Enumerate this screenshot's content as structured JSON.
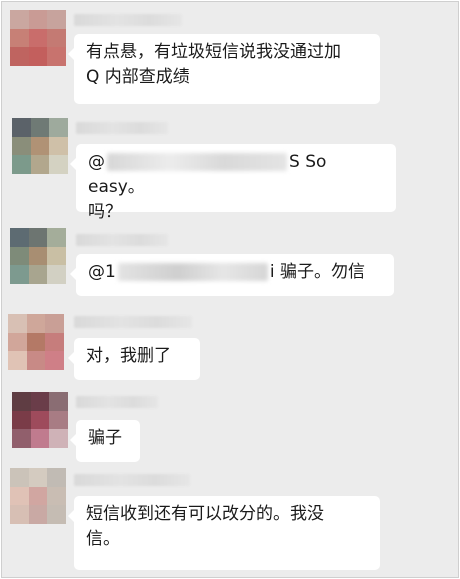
{
  "messages": [
    {
      "text_lines": [
        "有点悬，有垃圾短信说我没通过加",
        "Q 内部查成绩"
      ]
    },
    {
      "prefix": "@",
      "suffix": "S So easy。",
      "line2": "吗？"
    },
    {
      "prefix": "@1",
      "suffix": "i 骗子。勿信"
    },
    {
      "text": "对，我删了"
    },
    {
      "text": "骗子"
    },
    {
      "text_lines": [
        "短信收到还有可以改分的。我没",
        "信。"
      ]
    }
  ]
}
